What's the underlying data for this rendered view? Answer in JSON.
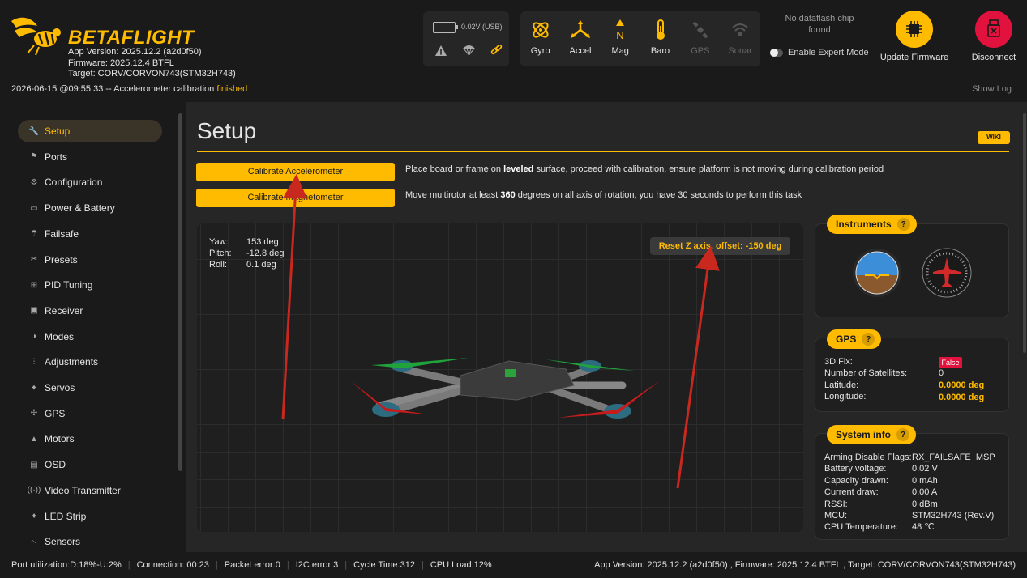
{
  "app": {
    "logo_text": "BETAFLIGHT",
    "app_version": "App Version: 2025.12.2 (a2d0f50)",
    "firmware": "Firmware: 2025.12.4 BTFL",
    "target": "Target: CORV/CORVON743(STM32H743)"
  },
  "status": {
    "prefix": "2026-06-15 @09:55:33 -- Accelerometer calibration ",
    "state": "finished",
    "show_log": "Show Log"
  },
  "battery": {
    "voltage": "0.02V (USB)"
  },
  "sensors": [
    {
      "label": "Gyro",
      "icon": "gyro-icon",
      "active": true
    },
    {
      "label": "Accel",
      "icon": "accel-icon",
      "active": true
    },
    {
      "label": "Mag",
      "icon": "mag-icon",
      "active": true
    },
    {
      "label": "Baro",
      "icon": "baro-icon",
      "active": true
    },
    {
      "label": "GPS",
      "icon": "gps-icon",
      "active": false
    },
    {
      "label": "Sonar",
      "icon": "sonar-icon",
      "active": false
    }
  ],
  "dataflash": "No dataflash chip found",
  "expert_mode": "Enable Expert Mode",
  "update_firmware": "Update Firmware",
  "disconnect": "Disconnect",
  "sidebar": {
    "items": [
      {
        "label": "Setup",
        "icon": "wrench-icon",
        "active": true
      },
      {
        "label": "Ports",
        "icon": "ports-icon"
      },
      {
        "label": "Configuration",
        "icon": "gear-icon"
      },
      {
        "label": "Power & Battery",
        "icon": "battery-icon"
      },
      {
        "label": "Failsafe",
        "icon": "parachute-icon"
      },
      {
        "label": "Presets",
        "icon": "presets-icon"
      },
      {
        "label": "PID Tuning",
        "icon": "pid-icon"
      },
      {
        "label": "Receiver",
        "icon": "receiver-icon"
      },
      {
        "label": "Modes",
        "icon": "modes-icon"
      },
      {
        "label": "Adjustments",
        "icon": "adjustments-icon"
      },
      {
        "label": "Servos",
        "icon": "servos-icon"
      },
      {
        "label": "GPS",
        "icon": "satellite-icon"
      },
      {
        "label": "Motors",
        "icon": "motor-icon"
      },
      {
        "label": "OSD",
        "icon": "osd-icon"
      },
      {
        "label": "Video Transmitter",
        "icon": "vtx-icon"
      },
      {
        "label": "LED Strip",
        "icon": "led-icon"
      },
      {
        "label": "Sensors",
        "icon": "sensors-icon"
      }
    ]
  },
  "setup": {
    "title": "Setup",
    "wiki": "WIKI",
    "calibrate_accel": "Calibrate Accelerometer",
    "accel_desc_1": "Place board or frame on ",
    "accel_desc_bold": "leveled",
    "accel_desc_2": " surface, proceed with calibration, ensure platform is not moving during calibration period",
    "calibrate_mag": "Calibrate Magnetometer",
    "mag_desc_1": "Move multirotor at least ",
    "mag_desc_bold": "360",
    "mag_desc_2": " degrees on all axis of rotation, you have 30 seconds to perform this task",
    "attitude": {
      "yaw_label": "Yaw:",
      "yaw": "153 deg",
      "pitch_label": "Pitch:",
      "pitch": "-12.8 deg",
      "roll_label": "Roll:",
      "roll": "0.1 deg"
    },
    "reset_z": "Reset Z axis, offset: -150 deg"
  },
  "instruments": {
    "title": "Instruments",
    "help": "?"
  },
  "gps": {
    "title": "GPS",
    "help": "?",
    "fix_label": "3D Fix:",
    "fix": "False",
    "sats_label": "Number of Satellites:",
    "sats": "0",
    "lat_label": "Latitude:",
    "lat": "0.0000 deg",
    "lon_label": "Longitude:",
    "lon": "0.0000 deg"
  },
  "sysinfo": {
    "title": "System info",
    "help": "?",
    "rows": [
      {
        "k": "Arming Disable Flags:",
        "v": "RX_FAILSAFE  MSP"
      },
      {
        "k": "Battery voltage:",
        "v": "0.02 V"
      },
      {
        "k": "Capacity drawn:",
        "v": "0 mAh"
      },
      {
        "k": "Current draw:",
        "v": "0.00 A"
      },
      {
        "k": "RSSI:",
        "v": "0 dBm"
      },
      {
        "k": "MCU:",
        "v": "STM32H743 (Rev.V)"
      },
      {
        "k": "CPU Temperature:",
        "v": "48 ℃"
      }
    ]
  },
  "footer": {
    "port_util": "Port utilization:D:18%-U:2%",
    "connection": "Connection: 00:23",
    "packet_error": "Packet error:0",
    "i2c_error": "I2C error:3",
    "cycle_time": "Cycle Time:312",
    "cpu_load": "CPU Load:12%",
    "right": "App Version: 2025.12.2 (a2d0f50) , Firmware: 2025.12.4 BTFL , Target: CORV/CORVON743(STM32H743)"
  },
  "colors": {
    "accent": "#ffbb00",
    "danger": "#e2123f",
    "arrow": "#c8281e"
  }
}
